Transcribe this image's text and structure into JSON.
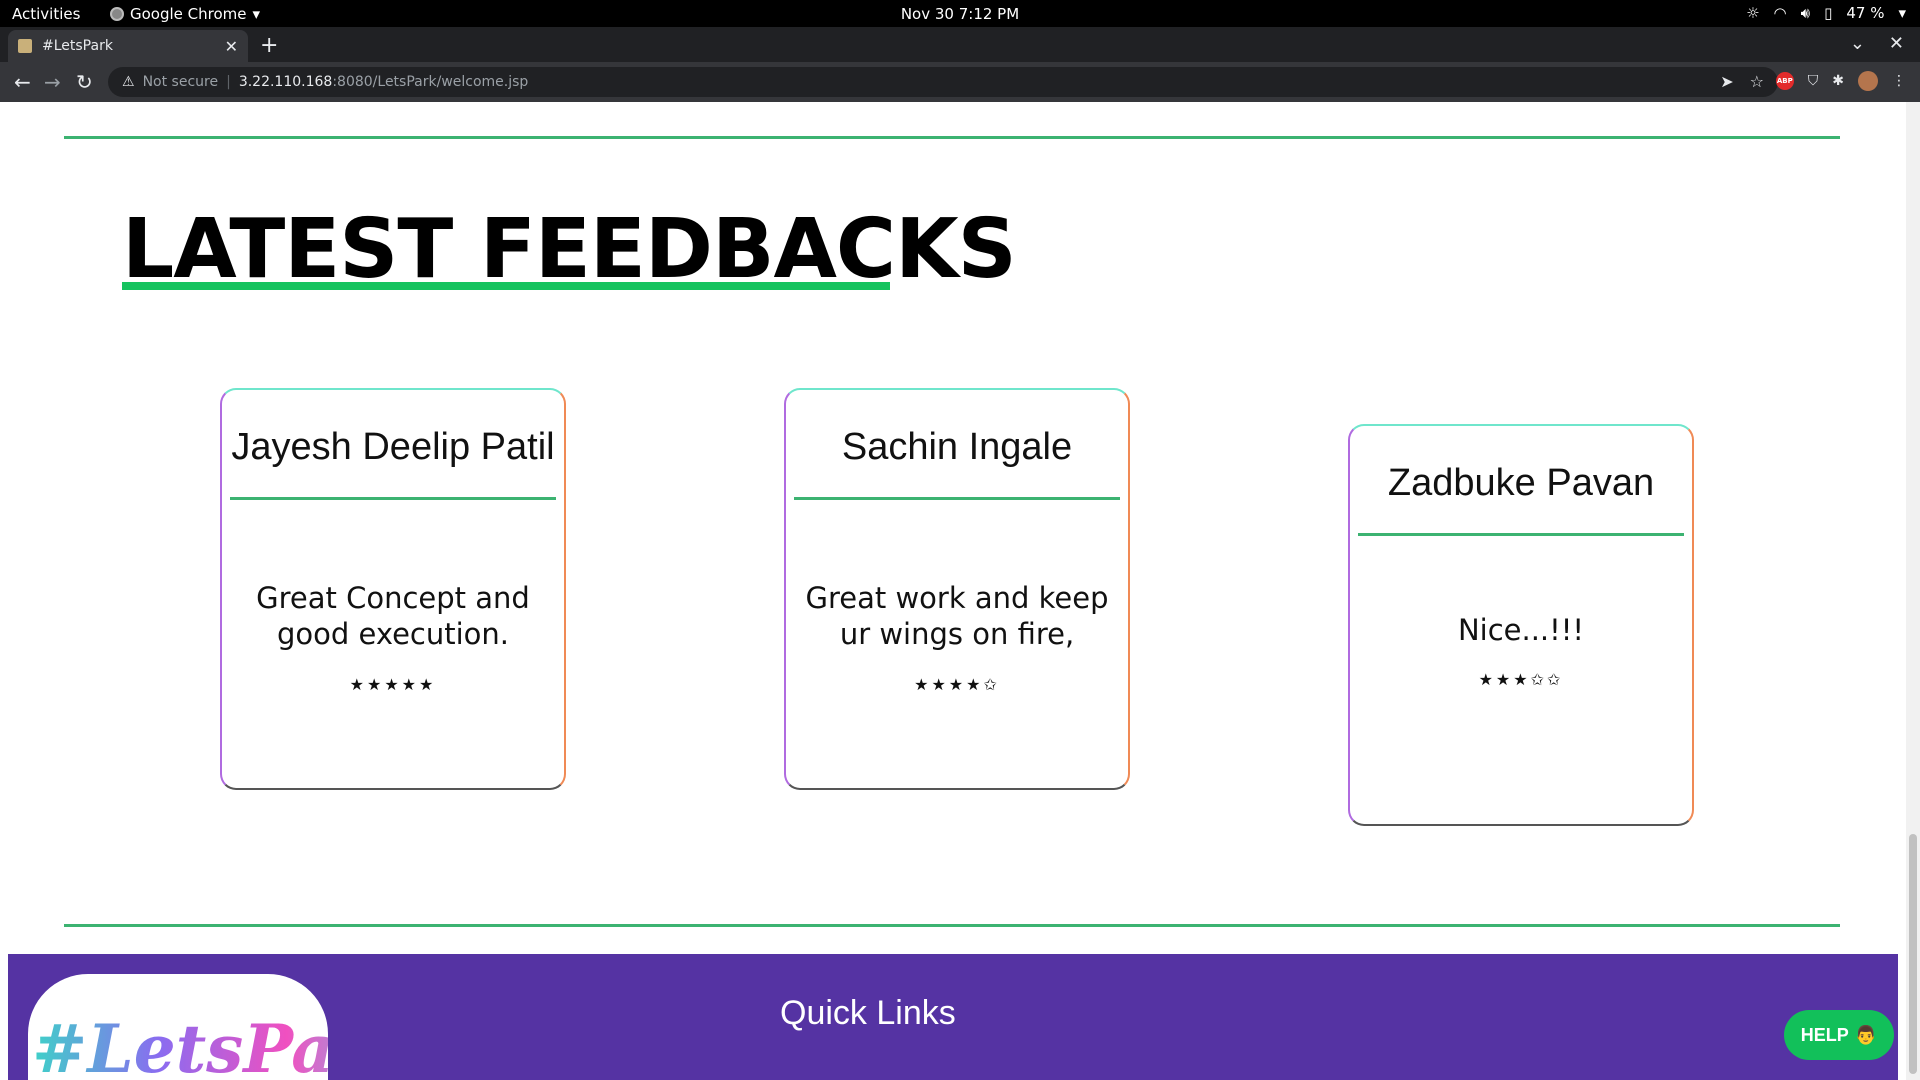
{
  "os": {
    "activities": "Activities",
    "app_name": "Google Chrome",
    "clock": "Nov 30  7:12 PM",
    "battery": "47 %"
  },
  "browser": {
    "tab_title": "#LetsPark",
    "url_warning": "Not secure",
    "url_host": "3.22.110.168",
    "url_path": ":8080/LetsPark/welcome.jsp",
    "abp_label": "ABP"
  },
  "page": {
    "section_title": "LATEST FEEDBACKS",
    "feedbacks": [
      {
        "name": "Jayesh Deelip Patil",
        "message": "Great Concept and good execution.",
        "stars": "★★★★★",
        "rating": 5
      },
      {
        "name": "Sachin Ingale",
        "message": "Great work and keep ur wings on fire,",
        "stars": "★★★★✩",
        "rating": 4
      },
      {
        "name": "Zadbuke Pavan",
        "message": "Nice...!!!",
        "stars": "★★★✩✩",
        "rating": 3
      }
    ],
    "footer": {
      "logo_text": "#LetsPark",
      "quick_links": "Quick Links"
    },
    "help_label": "HELP"
  },
  "colors": {
    "accent_green": "#3cb371",
    "footer_purple": "#5533a3",
    "help_green": "#12c05a"
  }
}
